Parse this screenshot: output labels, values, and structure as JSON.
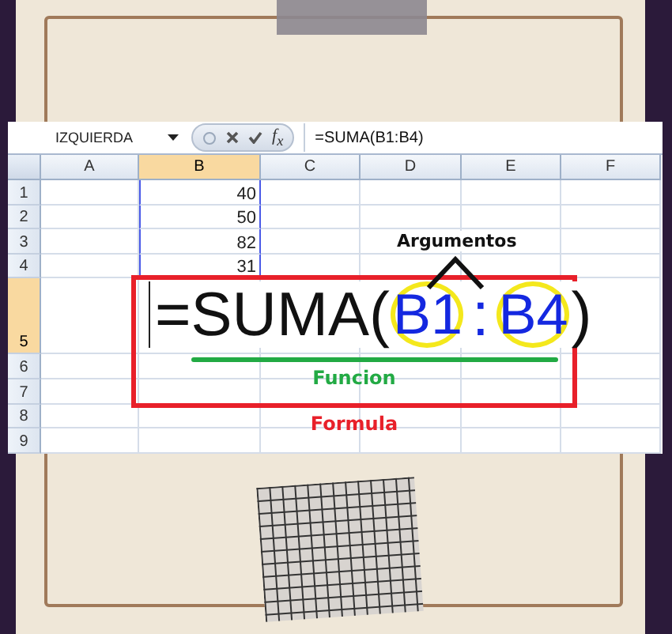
{
  "formula_bar": {
    "name_box": "IZQUIERDA",
    "function_button": "f$_{x}$",
    "formula": "=SUMA(B1:B4)"
  },
  "columns": [
    {
      "label": "A",
      "selected": false
    },
    {
      "label": "B",
      "selected": true
    },
    {
      "label": "C",
      "selected": false
    },
    {
      "label": "D",
      "selected": false
    },
    {
      "label": "E",
      "selected": false
    },
    {
      "label": "F",
      "selected": false
    }
  ],
  "rows": [
    {
      "label": "1",
      "selected": false,
      "in_range": true,
      "column_b": "40"
    },
    {
      "label": "2",
      "selected": false,
      "in_range": true,
      "column_b": "50"
    },
    {
      "label": "3",
      "selected": false,
      "in_range": true,
      "column_b": "82"
    },
    {
      "label": "4",
      "selected": false,
      "in_range": true,
      "column_b": "31"
    },
    {
      "label": "5",
      "selected": true,
      "in_range": false
    },
    {
      "label": "6",
      "selected": false,
      "in_range": false
    },
    {
      "label": "7",
      "selected": false,
      "in_range": false
    },
    {
      "label": "8",
      "selected": false,
      "in_range": false
    },
    {
      "label": "9",
      "selected": false,
      "in_range": false
    }
  ],
  "annotation": {
    "formula": {
      "prefix": "=SUMA(",
      "arguments": [
        "B1",
        "B4"
      ],
      "separator": ":",
      "suffix": ")"
    },
    "arguments_label": "Argumentos",
    "function_label": "Funcion",
    "formula_label": "Formula"
  }
}
